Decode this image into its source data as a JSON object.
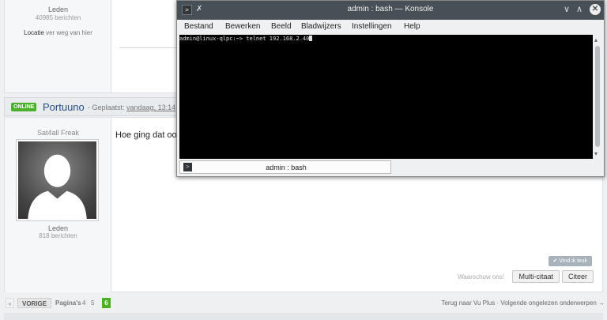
{
  "forum": {
    "prev_post": {
      "role": "Leden",
      "count": "40985 berichten",
      "location_label": "Locatie",
      "location_value": "ver weg van hier"
    },
    "post": {
      "online_badge": "ONLINE",
      "author": "Portuuno",
      "posted_prefix": "- Geplaatst:",
      "posted_time": "vandaag, 13:14",
      "rank": "Sat4all Freak",
      "role": "Leden",
      "count": "818 berichten",
      "message": "Hoe ging dat ook",
      "like_label": "Vind ik leuk",
      "warn_label": "Waarschuw ons!",
      "multiquote_label": "Multi-citaat",
      "quote_label": "Citeer"
    },
    "pager": {
      "first_arrow": "«",
      "prev_label": "VORIGE",
      "pages_label": "Pagina's",
      "pages": [
        "4",
        "5",
        "6"
      ],
      "current_page": "6",
      "right_text": "Terug naar Vu Plus · Volgende ongelezen onderwerpen →"
    },
    "colors": {
      "online": "#4caf2a",
      "author": "#2a4d80"
    }
  },
  "konsole": {
    "title": "admin : bash — Konsole",
    "menu": [
      "Bestand",
      "Bewerken",
      "Beeld",
      "Bladwijzers",
      "Instellingen",
      "Help"
    ],
    "terminal_line": "admin@linux-qlpc:~> telnet 192.168.2.40",
    "tab_label": "admin : bash",
    "icons": {
      "terminal": "terminal-icon",
      "pin": "pin-icon",
      "minimize": "chevron-down-icon",
      "maximize": "chevron-up-icon",
      "close": "close-icon"
    }
  }
}
